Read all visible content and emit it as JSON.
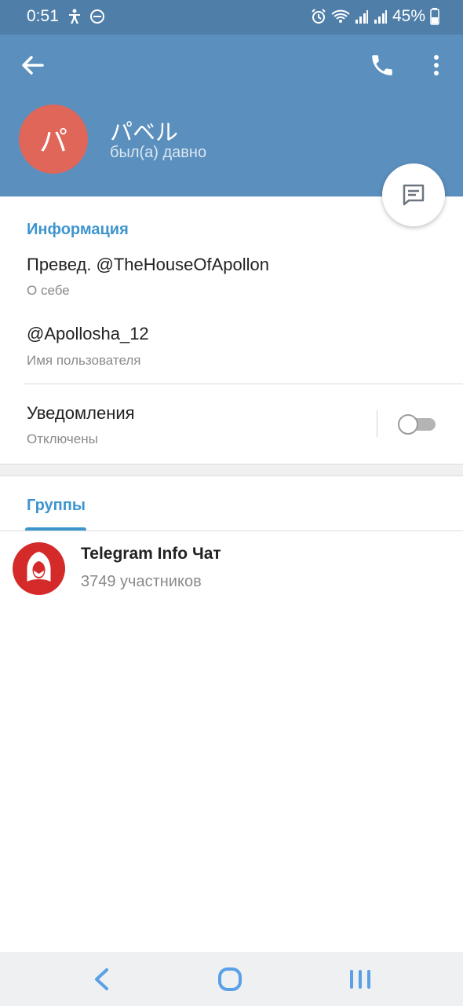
{
  "status_bar": {
    "time": "0:51",
    "battery": "45%",
    "icons": [
      "accessibility-icon",
      "do-not-disturb-icon",
      "alarm-icon",
      "wifi-icon",
      "signal-icon",
      "signal-icon",
      "battery-icon"
    ]
  },
  "header": {
    "avatar_letter": "パ",
    "name": "パベル",
    "last_seen": "был(а) давно",
    "colors": {
      "header": "#5b8fbd",
      "status_bar": "#4f7ea9",
      "avatar": "#e0665a"
    }
  },
  "info": {
    "section_title": "Информация",
    "bio_value": "Превед. @TheHouseOfApollon",
    "bio_label": "О себе",
    "username_value": "@Apollosha_12",
    "username_label": "Имя пользователя",
    "notifications_value": "Уведомления",
    "notifications_label": "Отключены",
    "notifications_enabled": false
  },
  "groups": {
    "tab_label": "Группы",
    "items": [
      {
        "name": "Telegram Info Чат",
        "members": "3749 участников"
      }
    ]
  },
  "accent": "#3d95cf"
}
